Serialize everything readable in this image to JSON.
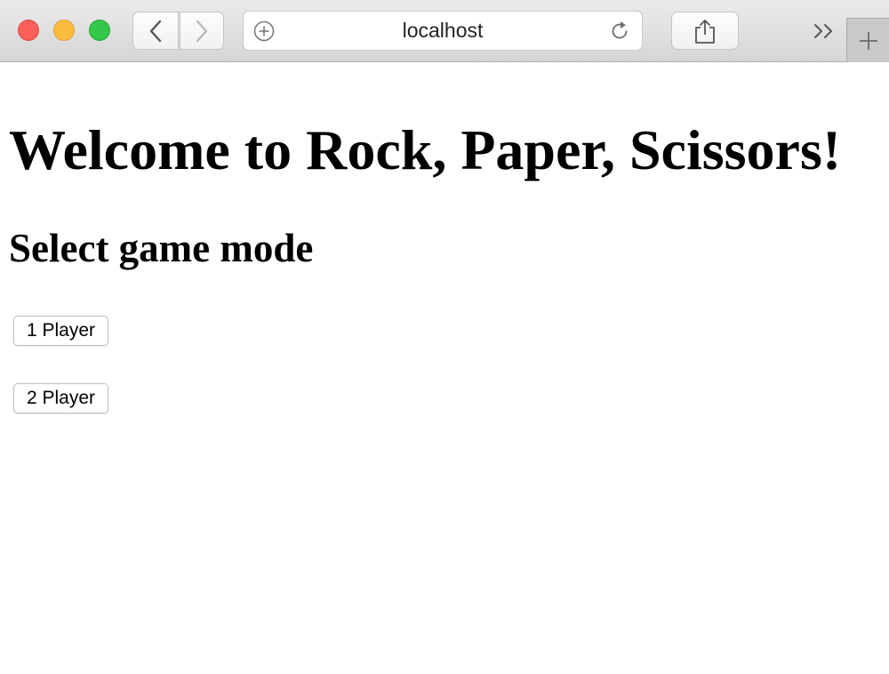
{
  "browser": {
    "address": "localhost",
    "icons": {
      "back": "chevron-left-icon",
      "forward": "chevron-right-icon",
      "add": "plus-circle-icon",
      "reload": "reload-icon",
      "share": "share-icon",
      "more": "double-chevron-right-icon",
      "new_tab": "plus-icon"
    },
    "colors": {
      "close": "#fc605c",
      "minimize": "#fdbc40",
      "zoom": "#34c84a"
    }
  },
  "page": {
    "title": "Welcome to Rock, Paper, Scissors!",
    "subtitle": "Select game mode",
    "buttons": [
      {
        "label": "1 Player"
      },
      {
        "label": "2 Player"
      }
    ]
  }
}
